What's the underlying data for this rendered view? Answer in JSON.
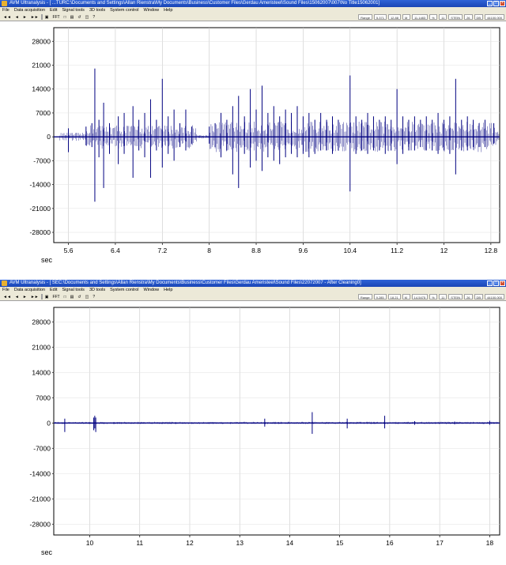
{
  "window1": {
    "title": "AVM Ultranalysis - [ ...TURC:\\Documents and Settings\\Allan Rienstra\\My Documents\\Business\\Customer Files\\Gerdau Ameristeel\\Sound Files\\15062007\\007\\No Title15062001]",
    "menu": [
      "File",
      "Data acquisition",
      "Edit",
      "Signal tools",
      "3D tools",
      "System control",
      "Window",
      "Help"
    ],
    "toolbar": [
      "◄◄",
      "◄",
      "►",
      "►►",
      "▣",
      "FFT",
      "□",
      "▤",
      "↺",
      "◫",
      "?"
    ],
    "status": [
      "Range",
      "5.371",
      "12.88",
      "M",
      "11.1483",
      "%",
      "11",
      "STEIN",
      "26",
      "DB",
      "44100.000"
    ],
    "unit_label": "sec"
  },
  "window2": {
    "title": "AVM Ultranalysis - [ SEC:\\Documents and Settings\\Allan Rienstra\\My Documents\\Business\\Customer Files\\Gerdau Ameristeel\\Sound Files\\22072007 - After Cleaning0]",
    "menu": [
      "File",
      "Data acquisition",
      "Edit",
      "Signal tools",
      "3D tools",
      "System control",
      "Window",
      "Help"
    ],
    "toolbar": [
      "◄◄",
      "◄",
      "►",
      "►►",
      "▣",
      "FFT",
      "□",
      "▤",
      "↺",
      "◫",
      "?"
    ],
    "status": [
      "Range",
      "9.285",
      "18.21",
      "M",
      "14.5475",
      "%",
      "11",
      "STEIN",
      "26",
      "DB",
      "44100.000"
    ],
    "unit_label": "sec"
  },
  "chart_data": [
    {
      "type": "line",
      "xlabel": "sec",
      "ylabel": "",
      "xlim": [
        5.35,
        12.95
      ],
      "ylim": [
        -31000,
        32000
      ],
      "yticks": [
        28000,
        21000,
        14000,
        7000,
        0,
        -7000,
        -14000,
        -21000,
        -28000
      ],
      "xticks": [
        5.6,
        6.4,
        7.2,
        8,
        8.8,
        9.6,
        10.4,
        11.2,
        12,
        12.8
      ],
      "grid": true,
      "color": "#000080",
      "spikes": [
        {
          "x": 5.6,
          "hi": 2500,
          "lo": -4500
        },
        {
          "x": 5.9,
          "hi": 3000,
          "lo": -2500
        },
        {
          "x": 6.0,
          "hi": 4000,
          "lo": -3000
        },
        {
          "x": 6.05,
          "hi": 20000,
          "lo": -19000
        },
        {
          "x": 6.12,
          "hi": 5000,
          "lo": -6000
        },
        {
          "x": 6.2,
          "hi": 10000,
          "lo": -15000
        },
        {
          "x": 6.3,
          "hi": 4000,
          "lo": -5000
        },
        {
          "x": 6.45,
          "hi": 6000,
          "lo": -8000
        },
        {
          "x": 6.55,
          "hi": 7000,
          "lo": -5000
        },
        {
          "x": 6.7,
          "hi": 9000,
          "lo": -12000
        },
        {
          "x": 6.8,
          "hi": 5000,
          "lo": -4000
        },
        {
          "x": 6.9,
          "hi": 7000,
          "lo": -6000
        },
        {
          "x": 7.0,
          "hi": 11000,
          "lo": -12000
        },
        {
          "x": 7.1,
          "hi": 5000,
          "lo": -4000
        },
        {
          "x": 7.2,
          "hi": 17000,
          "lo": -9000
        },
        {
          "x": 7.3,
          "hi": 6000,
          "lo": -5000
        },
        {
          "x": 7.4,
          "hi": 8000,
          "lo": -7000
        },
        {
          "x": 7.5,
          "hi": 4000,
          "lo": -3000
        },
        {
          "x": 7.6,
          "hi": 8000,
          "lo": -4000
        },
        {
          "x": 7.7,
          "hi": 3000,
          "lo": -2000
        },
        {
          "x": 8.0,
          "hi": 3000,
          "lo": -2000
        },
        {
          "x": 8.1,
          "hi": 4000,
          "lo": -3000
        },
        {
          "x": 8.2,
          "hi": 7000,
          "lo": -6000
        },
        {
          "x": 8.3,
          "hi": 5000,
          "lo": -4000
        },
        {
          "x": 8.4,
          "hi": 9000,
          "lo": -11000
        },
        {
          "x": 8.5,
          "hi": 12000,
          "lo": -15000
        },
        {
          "x": 8.6,
          "hi": 6000,
          "lo": -5000
        },
        {
          "x": 8.7,
          "hi": 14000,
          "lo": -9000
        },
        {
          "x": 8.8,
          "hi": 8000,
          "lo": -7000
        },
        {
          "x": 8.9,
          "hi": 15000,
          "lo": -10000
        },
        {
          "x": 9.0,
          "hi": 7000,
          "lo": -6000
        },
        {
          "x": 9.1,
          "hi": 9000,
          "lo": -7000
        },
        {
          "x": 9.2,
          "hi": 6000,
          "lo": -8000
        },
        {
          "x": 9.3,
          "hi": 8000,
          "lo": -6000
        },
        {
          "x": 9.4,
          "hi": 7000,
          "lo": -5000
        },
        {
          "x": 9.5,
          "hi": 9000,
          "lo": -6000
        },
        {
          "x": 9.6,
          "hi": 6000,
          "lo": -5000
        },
        {
          "x": 9.7,
          "hi": 7000,
          "lo": -6000
        },
        {
          "x": 9.8,
          "hi": 5000,
          "lo": -5000
        },
        {
          "x": 9.9,
          "hi": 7000,
          "lo": -4000
        },
        {
          "x": 10.0,
          "hi": 5000,
          "lo": -4000
        },
        {
          "x": 10.1,
          "hi": 6000,
          "lo": -5000
        },
        {
          "x": 10.2,
          "hi": 5000,
          "lo": -4000
        },
        {
          "x": 10.4,
          "hi": 18000,
          "lo": -16000
        },
        {
          "x": 10.5,
          "hi": 6000,
          "lo": -5000
        },
        {
          "x": 10.6,
          "hi": 5000,
          "lo": -4000
        },
        {
          "x": 10.7,
          "hi": 7000,
          "lo": -5000
        },
        {
          "x": 10.8,
          "hi": 6000,
          "lo": -4000
        },
        {
          "x": 10.9,
          "hi": 5000,
          "lo": -4000
        },
        {
          "x": 11.0,
          "hi": 6000,
          "lo": -5000
        },
        {
          "x": 11.1,
          "hi": 5000,
          "lo": -4000
        },
        {
          "x": 11.2,
          "hi": 14000,
          "lo": -8000
        },
        {
          "x": 11.3,
          "hi": 6000,
          "lo": -5000
        },
        {
          "x": 11.4,
          "hi": 5000,
          "lo": -4000
        },
        {
          "x": 11.5,
          "hi": 6000,
          "lo": -4000
        },
        {
          "x": 11.6,
          "hi": 5000,
          "lo": -3000
        },
        {
          "x": 11.7,
          "hi": 6000,
          "lo": -4000
        },
        {
          "x": 11.8,
          "hi": 5000,
          "lo": -4000
        },
        {
          "x": 11.9,
          "hi": 7000,
          "lo": -5000
        },
        {
          "x": 12.0,
          "hi": 5000,
          "lo": -4000
        },
        {
          "x": 12.1,
          "hi": 6000,
          "lo": -5000
        },
        {
          "x": 12.2,
          "hi": 17000,
          "lo": -11000
        },
        {
          "x": 12.3,
          "hi": 5000,
          "lo": -4000
        },
        {
          "x": 12.4,
          "hi": 6000,
          "lo": -4000
        },
        {
          "x": 12.5,
          "hi": 5000,
          "lo": -3000
        },
        {
          "x": 12.6,
          "hi": 4000,
          "lo": -3000
        },
        {
          "x": 12.7,
          "hi": 5000,
          "lo": -3000
        },
        {
          "x": 12.85,
          "hi": 4000,
          "lo": -2000
        }
      ]
    },
    {
      "type": "line",
      "xlabel": "sec",
      "ylabel": "",
      "xlim": [
        9.28,
        18.2
      ],
      "ylim": [
        -31000,
        32000
      ],
      "yticks": [
        28000,
        21000,
        14000,
        7000,
        0,
        -7000,
        -14000,
        -21000,
        -28000
      ],
      "xticks": [
        10,
        11,
        12,
        13,
        14,
        15,
        16,
        17,
        18
      ],
      "grid": true,
      "color": "#000080",
      "spikes": [
        {
          "x": 9.5,
          "hi": 1200,
          "lo": -2500
        },
        {
          "x": 10.08,
          "hi": 1500,
          "lo": -2000
        },
        {
          "x": 10.1,
          "hi": 2000,
          "lo": -1500
        },
        {
          "x": 10.12,
          "hi": 1500,
          "lo": -2500
        },
        {
          "x": 13.5,
          "hi": 1200,
          "lo": -1000
        },
        {
          "x": 14.45,
          "hi": 3000,
          "lo": -3000
        },
        {
          "x": 15.15,
          "hi": 1200,
          "lo": -1500
        },
        {
          "x": 15.9,
          "hi": 2000,
          "lo": -1500
        },
        {
          "x": 16.5,
          "hi": 500,
          "lo": -500
        },
        {
          "x": 17.3,
          "hi": 400,
          "lo": -400
        },
        {
          "x": 18.0,
          "hi": 600,
          "lo": -500
        }
      ]
    }
  ]
}
